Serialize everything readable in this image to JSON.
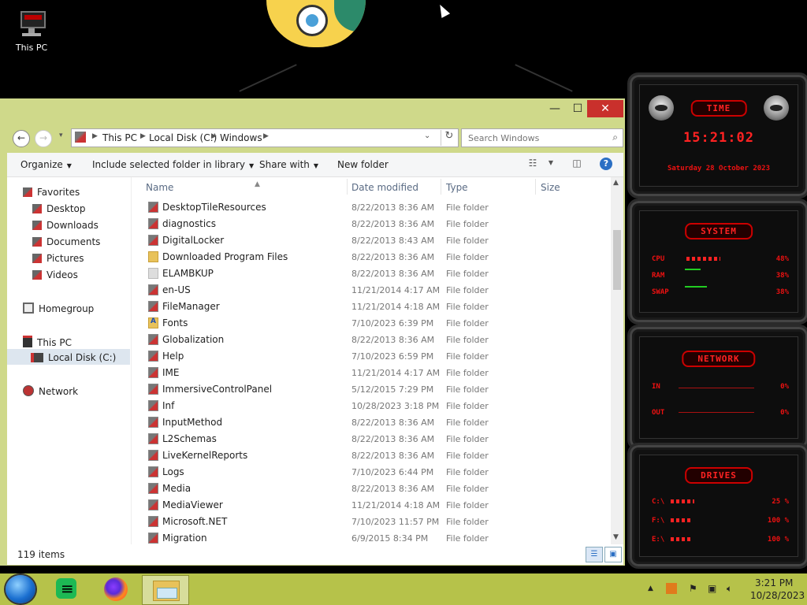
{
  "desktop": {
    "this_pc_label": "This PC"
  },
  "window": {
    "min_glyph": "—",
    "max_glyph": "☐",
    "close_glyph": "✕",
    "nav": {
      "back_glyph": "←",
      "forward_glyph": "→",
      "recent_glyph": "▾"
    },
    "breadcrumb": [
      "This PC",
      "Local Disk (C:)",
      "Windows"
    ],
    "search_placeholder": "Search Windows",
    "toolbar": {
      "organize": "Organize",
      "include": "Include selected folder in library",
      "share": "Share with",
      "new_folder": "New folder"
    },
    "nav_pane": {
      "favorites": "Favorites",
      "desktop": "Desktop",
      "downloads": "Downloads",
      "documents": "Documents",
      "pictures": "Pictures",
      "videos": "Videos",
      "homegroup": "Homegroup",
      "this_pc": "This PC",
      "local_disk": "Local Disk (C:)",
      "network": "Network"
    },
    "columns": {
      "name": "Name",
      "date": "Date modified",
      "type": "Type",
      "size": "Size"
    },
    "files": [
      {
        "name": "DesktopTileResources",
        "date": "8/22/2013 8:36 AM",
        "type": "File folder",
        "icon": "folder-icon"
      },
      {
        "name": "diagnostics",
        "date": "8/22/2013 8:36 AM",
        "type": "File folder",
        "icon": "folder-icon"
      },
      {
        "name": "DigitalLocker",
        "date": "8/22/2013 8:43 AM",
        "type": "File folder",
        "icon": "folder-icon"
      },
      {
        "name": "Downloaded Program Files",
        "date": "8/22/2013 8:36 AM",
        "type": "File folder",
        "icon": "yellow-folder-icon"
      },
      {
        "name": "ELAMBKUP",
        "date": "8/22/2013 8:36 AM",
        "type": "File folder",
        "icon": "pale-folder-icon"
      },
      {
        "name": "en-US",
        "date": "11/21/2014 4:17 AM",
        "type": "File folder",
        "icon": "folder-icon"
      },
      {
        "name": "FileManager",
        "date": "11/21/2014 4:18 AM",
        "type": "File folder",
        "icon": "folder-icon"
      },
      {
        "name": "Fonts",
        "date": "7/10/2023 6:39 PM",
        "type": "File folder",
        "icon": "fonts-folder-icon"
      },
      {
        "name": "Globalization",
        "date": "8/22/2013 8:36 AM",
        "type": "File folder",
        "icon": "folder-icon"
      },
      {
        "name": "Help",
        "date": "7/10/2023 6:59 PM",
        "type": "File folder",
        "icon": "folder-icon"
      },
      {
        "name": "IME",
        "date": "11/21/2014 4:17 AM",
        "type": "File folder",
        "icon": "folder-icon"
      },
      {
        "name": "ImmersiveControlPanel",
        "date": "5/12/2015 7:29 PM",
        "type": "File folder",
        "icon": "folder-icon"
      },
      {
        "name": "Inf",
        "date": "10/28/2023 3:18 PM",
        "type": "File folder",
        "icon": "folder-icon"
      },
      {
        "name": "InputMethod",
        "date": "8/22/2013 8:36 AM",
        "type": "File folder",
        "icon": "folder-icon"
      },
      {
        "name": "L2Schemas",
        "date": "8/22/2013 8:36 AM",
        "type": "File folder",
        "icon": "folder-icon"
      },
      {
        "name": "LiveKernelReports",
        "date": "8/22/2013 8:36 AM",
        "type": "File folder",
        "icon": "folder-icon"
      },
      {
        "name": "Logs",
        "date": "7/10/2023 6:44 PM",
        "type": "File folder",
        "icon": "folder-icon"
      },
      {
        "name": "Media",
        "date": "8/22/2013 8:36 AM",
        "type": "File folder",
        "icon": "folder-icon"
      },
      {
        "name": "MediaViewer",
        "date": "11/21/2014 4:18 AM",
        "type": "File folder",
        "icon": "folder-icon"
      },
      {
        "name": "Microsoft.NET",
        "date": "7/10/2023 11:57 PM",
        "type": "File folder",
        "icon": "folder-icon"
      },
      {
        "name": "Migration",
        "date": "6/9/2015 8:34 PM",
        "type": "File folder",
        "icon": "folder-icon"
      }
    ],
    "status": {
      "item_count": "119 items"
    }
  },
  "widgets": {
    "time": {
      "label": "TIME",
      "clock": "15:21:02",
      "date": "Saturday 28 October 2023"
    },
    "system": {
      "label": "SYSTEM",
      "cpu_label": "CPU",
      "cpu_value": "48%",
      "ram_label": "RAM",
      "ram_value": "38%",
      "swap_label": "SWAP",
      "swap_value": "38%"
    },
    "network": {
      "label": "NETWORK",
      "in_label": "IN",
      "in_value": "0%",
      "out_label": "OUT",
      "out_value": "0%"
    },
    "drives": {
      "label": "DRIVES",
      "c_label": "C:\\",
      "c_value": "25 %",
      "f_label": "F:\\",
      "f_value": "100 %",
      "e_label": "E:\\",
      "e_value": "100 %"
    },
    "accent": "#ff2222"
  },
  "taskbar": {
    "apps": [
      "spotify-icon",
      "firefox-icon",
      "file-explorer-icon"
    ],
    "time": "3:21 PM",
    "date": "10/28/2023"
  }
}
